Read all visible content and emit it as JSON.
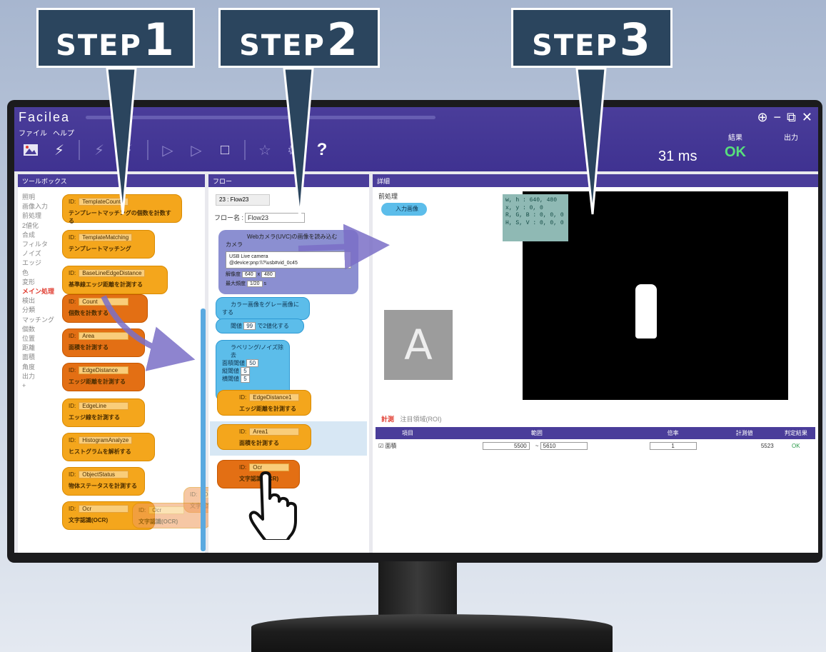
{
  "steps": [
    {
      "word": "STEP",
      "num": "1"
    },
    {
      "word": "STEP",
      "num": "2"
    },
    {
      "word": "STEP",
      "num": "3"
    }
  ],
  "app": {
    "brand": "Facilea",
    "menus": [
      "ファイル",
      "ヘルプ"
    ],
    "window_buttons": [
      "⊕",
      "−",
      "⧉",
      "✕"
    ],
    "toolbar_icons": [
      "image-icon",
      "flash-icon",
      "flash-all-icon",
      "flash-step-icon",
      "play-icon",
      "step-play-icon",
      "stop-icon",
      "favorite-icon",
      "settings-icon",
      "help-icon"
    ],
    "help_glyph": "?",
    "elapsed": "31 ms",
    "result_label": "結果",
    "result_value": "OK",
    "output_label": "出力",
    "accent": "#4a3d9a"
  },
  "toolbox": {
    "title": "ツールボックス",
    "categories": [
      "照明",
      "画像入力",
      "前処理",
      "2値化",
      "合成",
      "フィルタ",
      "ノイズ",
      "エッジ",
      "色",
      "変形",
      "メイン処理",
      "検出",
      "分類",
      "マッチング",
      "個数",
      "位置",
      "距離",
      "面積",
      "角度",
      "出力",
      "+"
    ],
    "active_category": "メイン処理",
    "blocks": [
      {
        "id": "TemplateCount",
        "desc": "テンプレートマッチングの個数を計数する"
      },
      {
        "id": "TemplateMatching",
        "desc": "テンプレートマッチング"
      },
      {
        "id": "BaseLineEdgeDistance",
        "desc": "基準線エッジ距離を計測する"
      },
      {
        "id": "Count",
        "desc": "個数を計数する"
      },
      {
        "id": "Area",
        "desc": "面積を計測する"
      },
      {
        "id": "EdgeDistance",
        "desc": "エッジ距離を計測する"
      },
      {
        "id": "EdgeLine",
        "desc": "エッジ線を計測する"
      },
      {
        "id": "HistogramAnalyze",
        "desc": "ヒストグラムを解析する"
      },
      {
        "id": "ObjectStatus",
        "desc": "物体ステータスを計測する"
      },
      {
        "id": "Ocr",
        "desc": "文字認識(OCR)"
      }
    ],
    "drag_ghosts": [
      {
        "id": "Ocr",
        "desc": "文字認識(OCR)"
      },
      {
        "id": "Ocr",
        "desc": "文字認識(OCR)"
      }
    ]
  },
  "flow": {
    "title": "フロー",
    "selected": "23 : Flow23",
    "name_label": "フロー名 :",
    "name_value": "Flow23",
    "camera": {
      "title": "Webカメラ(UVC)の画像を読み込む",
      "label": "カメラ",
      "source_line1": "USB Live camera",
      "source_line2": "@device:pnp:\\\\?\\usb#vid_0c45",
      "width_label": "解像度",
      "width": "640",
      "height": "480",
      "fps_label": "最大頻度",
      "fps": "1/20",
      "fps_unit": "s"
    },
    "gray_block": "カラー画像をグレー画像にする",
    "binarize": {
      "label": "閾値",
      "value": "99",
      "suffix": "で2値化する"
    },
    "labeling": {
      "title": "ラベリング/ノイズ除去",
      "fields": [
        {
          "label": "面積閾値",
          "value": "50"
        },
        {
          "label": "縦閾値",
          "value": "5"
        },
        {
          "label": "横閾値",
          "value": "5"
        }
      ]
    },
    "edge_block": {
      "id": "EdgeDistance1",
      "desc": "エッジ距離を計測する"
    },
    "area_block": {
      "id": "Area1",
      "desc": "面積を計測する"
    },
    "ocr_block": {
      "id": "Ocr",
      "desc": "文字認識(OCR)"
    }
  },
  "detail": {
    "title": "詳細",
    "pre_label": "前処理",
    "pill_label": "入力画像",
    "thumb_letter": "A",
    "readout": [
      "w, h : 640, 480",
      "x, y : 0, 0",
      "R, G, B : 0, 0, 0",
      "H, S, V : 0, 0, 0"
    ],
    "tab_active": "計測",
    "tab_other": "注目領域(ROI)",
    "table": {
      "headers": [
        "項目",
        "範囲",
        "",
        "倍率",
        "計測値",
        "判定結果"
      ],
      "rows": [
        {
          "item": "☑ 面積",
          "min": "5500",
          "sep": "~",
          "max": "5610",
          "scale": "1",
          "measured": "5523",
          "judge": "OK"
        }
      ]
    }
  }
}
